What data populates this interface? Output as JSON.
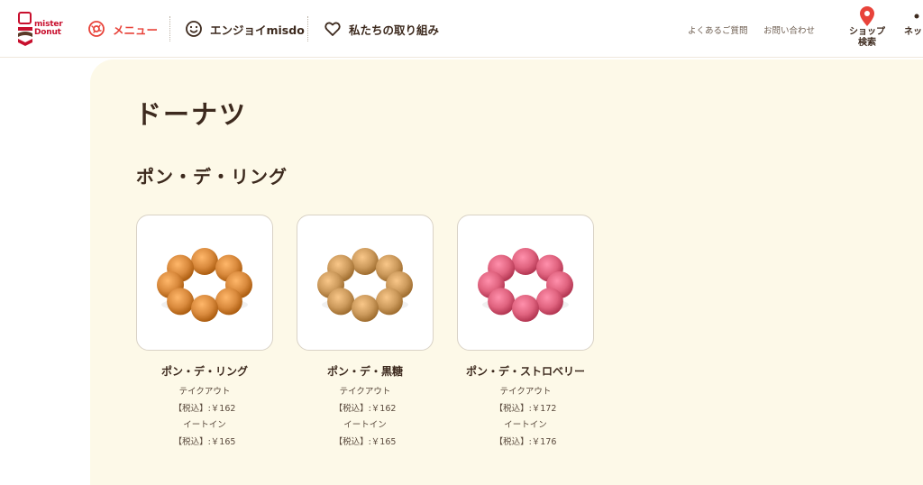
{
  "header": {
    "logo_line1": "mister",
    "logo_line2": "Donut",
    "nav": {
      "menu": "メニュー",
      "enjoy": "エンジョイmisdo",
      "effort": "私たちの取り組み"
    },
    "utility": {
      "faq": "よくあるご質問",
      "contact": "お問い合わせ"
    },
    "shop_search": "ショップ\n検索",
    "net_order": "ネッ",
    "icons": {
      "logo": "mister-donut-logo",
      "menu": "donut-icon",
      "enjoy": "smile-icon",
      "effort": "heart-icon",
      "shop_search": "location-pin-icon"
    },
    "colors": {
      "accent": "#e8433a",
      "text": "#3d2a1e",
      "panel_bg": "#fdf9e8"
    }
  },
  "main": {
    "title": "ドーナツ",
    "section_title": "ポン・デ・リング",
    "products": [
      {
        "name": "ポン・デ・リング",
        "takeout_label": "テイクアウト",
        "takeout_price": "【税込】:￥162",
        "eatin_label": "イートイン",
        "eatin_price": "【税込】:￥165",
        "color": "#d98a3d"
      },
      {
        "name": "ポン・デ・黒糖",
        "takeout_label": "テイクアウト",
        "takeout_price": "【税込】:￥162",
        "eatin_label": "イートイン",
        "eatin_price": "【税込】:￥165",
        "color": "#cc9a5c"
      },
      {
        "name": "ポン・デ・ストロベリー",
        "takeout_label": "テイクアウト",
        "takeout_price": "【税込】:￥172",
        "eatin_label": "イートイン",
        "eatin_price": "【税込】:￥176",
        "color": "#e0637f"
      }
    ]
  }
}
